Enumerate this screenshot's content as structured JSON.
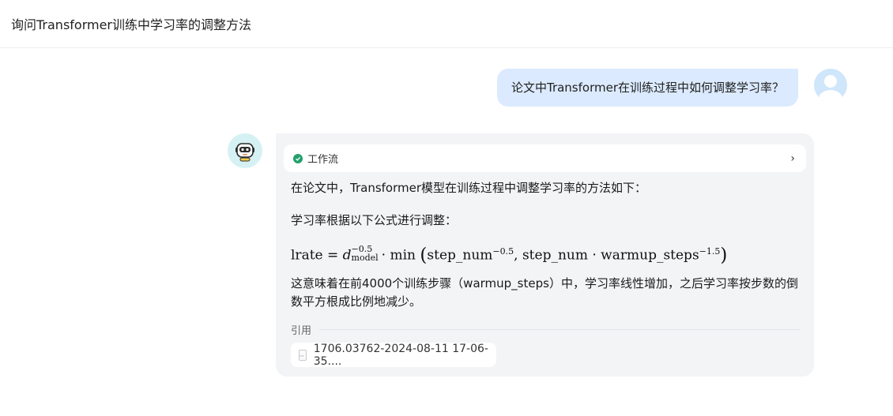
{
  "header": {
    "title": "询问Transformer训练中学习率的调整方法"
  },
  "user_message": {
    "text": "论文中Transformer在训练过程中如何调整学习率？"
  },
  "assistant": {
    "workflow_label": "工作流",
    "intro": "在论文中，Transformer模型在训练过程中调整学习率的方法如下：",
    "formula_intro": "学习率根据以下公式进行调整：",
    "formula": {
      "lhs": "lrate",
      "d": "d",
      "d_sup": "−0.5",
      "d_sub": "model",
      "min": "min",
      "arg1": "step_num",
      "arg1_sup": "−0.5",
      "arg2": "step_num · warmup_steps",
      "arg2_sup": "−1.5"
    },
    "explanation": "这意味着在前4000个训练步骤（warmup_steps）中，学习率线性增加，之后学习率按步数的倒数平方根成比例地减少。",
    "citation_label": "引用",
    "citation_file": "1706.03762-2024-08-11 17-06-35...."
  },
  "colors": {
    "user_bubble": "#dbeafe",
    "assistant_card": "#f3f4f6",
    "success": "#22a06b"
  }
}
